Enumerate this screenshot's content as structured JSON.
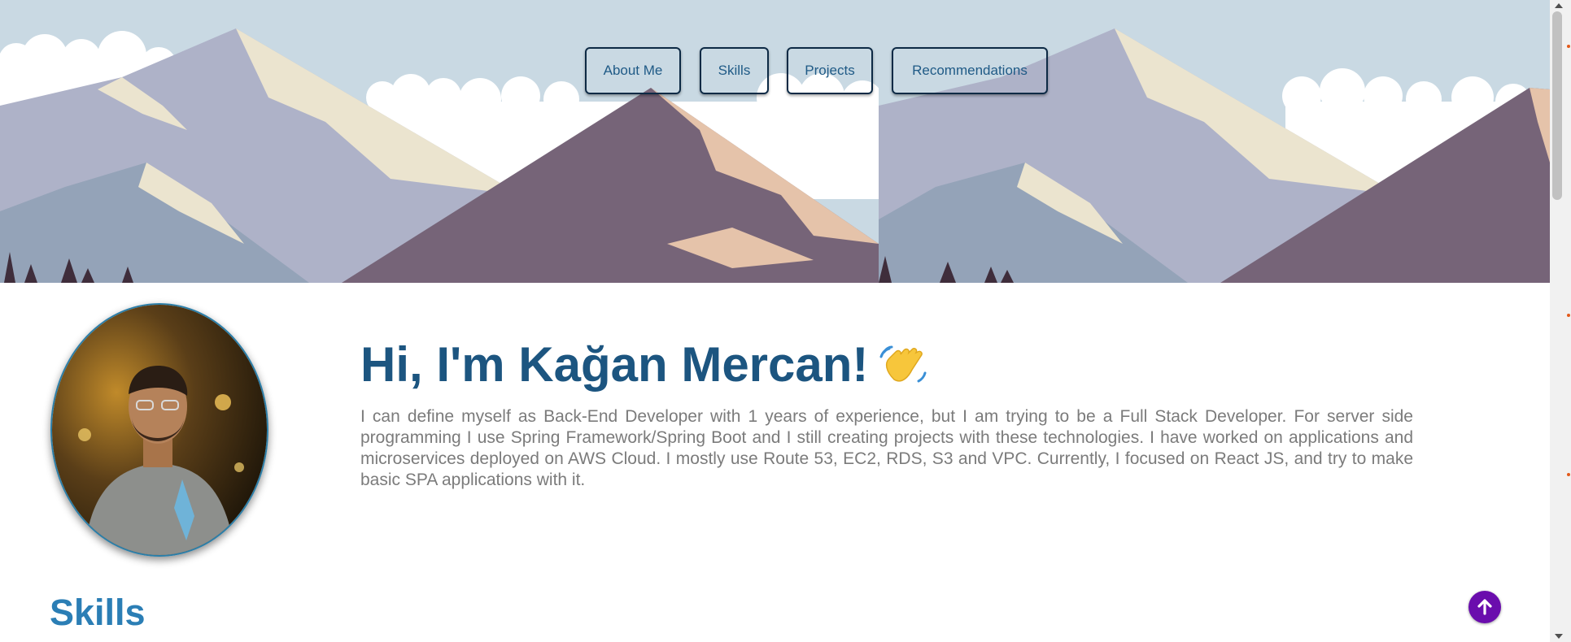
{
  "nav": {
    "items": [
      "About Me",
      "Skills",
      "Projects",
      "Recommendations"
    ]
  },
  "profile": {
    "name_greeting": "Hi, I'm Kağan Mercan!",
    "wave_emoji": "👋",
    "bio": "I can define myself as Back-End Developer with 1 years of experience, but I am trying to be a Full Stack Developer. For server side programming I use Spring Framework/Spring Boot and I still creating projects with these technologies. I have worked on applications and microservices deployed on AWS Cloud. I mostly use Route 53, EC2, RDS, S3 and VPC. Currently, I focused on React JS, and try to make basic SPA applications with it."
  },
  "sections": {
    "skills_title": "Skills"
  },
  "icons": {
    "scroll_top": "arrow-up-icon",
    "wave": "waving-hand-icon"
  },
  "colors": {
    "heading": "#1c5580",
    "section_title": "#2b7eb5",
    "nav_border": "#0d2a45",
    "nav_text": "#1f5a86",
    "scroll_top_bg": "#6a0dad",
    "bio_text": "#7b7b7b"
  }
}
